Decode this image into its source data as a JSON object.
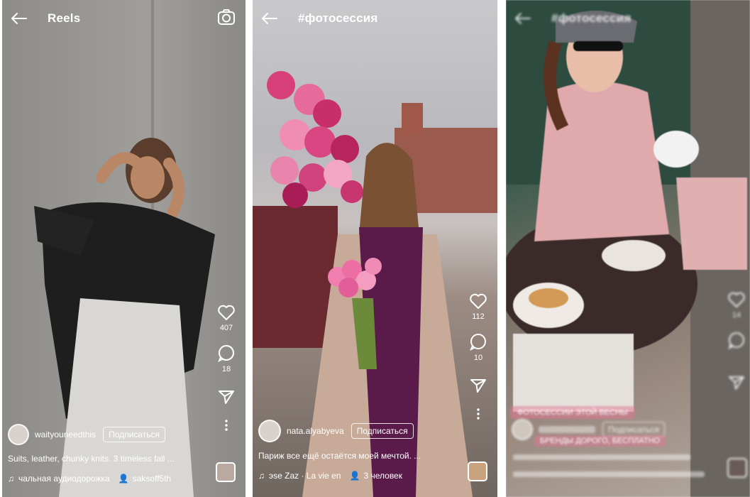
{
  "screens": [
    {
      "title": "Reels",
      "likes": "407",
      "comments": "18",
      "username": "waityouneedthis",
      "follow_label": "Подписаться",
      "caption": "Suits, leather, chunky knits. 3 timeless fall ...",
      "audio": "чальная аудиодорожка",
      "audio_user": "saksoff5th"
    },
    {
      "title": "#фотосессия",
      "likes": "112",
      "comments": "10",
      "username": "nata.alyabyeva",
      "follow_label": "Подписаться",
      "caption": "Париж все ещё остаётся моей мечтой. ...",
      "audio": "эse  Zaz · La vie en",
      "audio_users": "3 человек"
    },
    {
      "title": "#фотосессия",
      "likes": "14",
      "comments": "",
      "username": "",
      "follow_label": "Подписаться",
      "overlay_text": "ФОТОСЕССИИ ЭТОЙ ВЕСНЫ",
      "overlay_text2": "БРЕНДЫ ДОРОГО, БЕСПЛАТНО",
      "caption": "",
      "audio": ""
    }
  ],
  "colors": {
    "icon": "#ffffff",
    "follow_border": "#ffffff",
    "overlay_pink": "#e07896"
  }
}
